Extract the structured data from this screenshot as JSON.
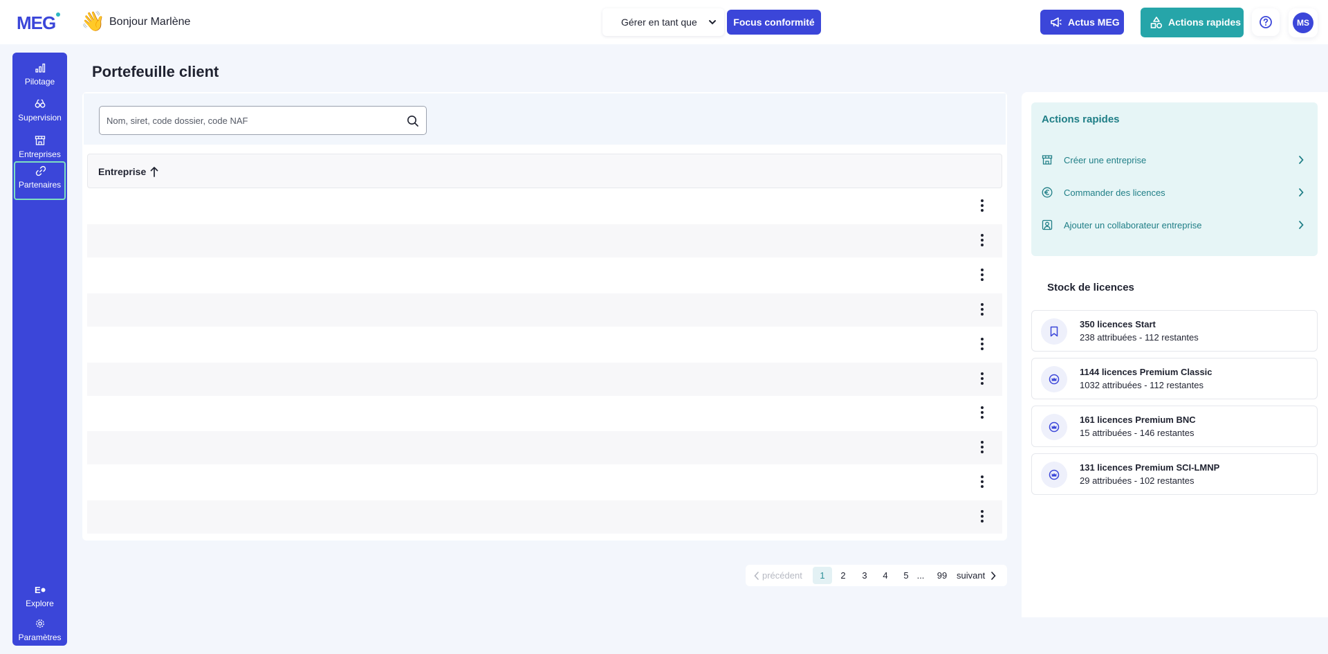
{
  "header": {
    "logo": "MEG",
    "greeting_emoji": "👋",
    "greeting": "Bonjour Marlène",
    "manage_as": "Gérer en tant que",
    "focus_button": "Focus conformité",
    "news_button": "Actus MEG",
    "quick_actions_button": "Actions rapides",
    "avatar_initials": "MS",
    "accent_color": "#3b46d9",
    "teal_color": "#26a5a9"
  },
  "sidebar": {
    "items": [
      {
        "label": "Pilotage",
        "icon": "bar-chart-icon"
      },
      {
        "label": "Supervision",
        "icon": "binoculars-icon"
      },
      {
        "label": "Entreprises",
        "icon": "store-icon"
      },
      {
        "label": "Partenaires",
        "icon": "link-icon",
        "active": true
      }
    ],
    "bottom_items": [
      {
        "label": "Explore",
        "icon": "explore-icon"
      },
      {
        "label": "Paramètres",
        "icon": "gear-icon"
      }
    ]
  },
  "main": {
    "title": "Portefeuille client",
    "search_placeholder": "Nom, siret, code dossier, code NAF",
    "column_header": "Entreprise",
    "sort": "ascending",
    "row_count": 10
  },
  "pagination": {
    "prev": "précédent",
    "pages": [
      "1",
      "2",
      "3",
      "4",
      "5",
      "...",
      "99"
    ],
    "current": "1",
    "next": "suivant"
  },
  "quick_actions": {
    "title": "Actions rapides",
    "items": [
      {
        "label": "Créer une entreprise",
        "icon": "store-icon"
      },
      {
        "label": "Commander des licences",
        "icon": "euro-icon"
      },
      {
        "label": "Ajouter un collaborateur entreprise",
        "icon": "user-badge-icon"
      }
    ]
  },
  "stock": {
    "title": "Stock de licences",
    "licences": [
      {
        "title": "350 licences Start",
        "detail": "238 attribuées - 112 restantes",
        "icon": "bookmark-icon"
      },
      {
        "title": "1144 licences Premium Classic",
        "detail": "1032 attribuées - 112 restantes",
        "icon": "crown-icon"
      },
      {
        "title": "161 licences Premium BNC",
        "detail": "15 attribuées - 146 restantes",
        "icon": "crown-icon"
      },
      {
        "title": "131 licences Premium SCI-LMNP",
        "detail": "29 attribuées - 102 restantes",
        "icon": "crown-icon"
      }
    ]
  }
}
